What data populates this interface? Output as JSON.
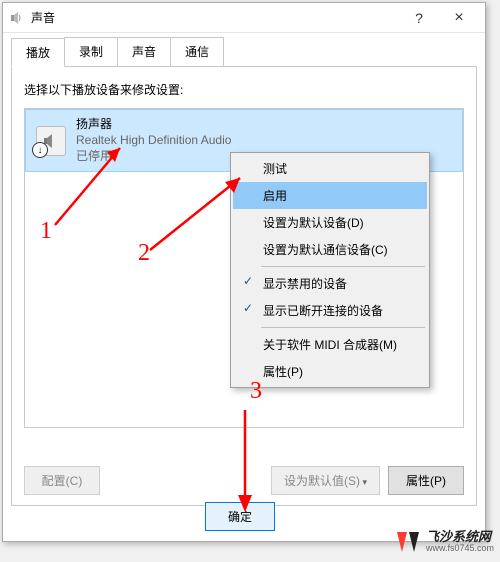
{
  "window": {
    "title": "声音",
    "close": "×",
    "help": "?"
  },
  "tabs": [
    "播放",
    "录制",
    "声音",
    "通信"
  ],
  "instruction": "选择以下播放设备来修改设置:",
  "device": {
    "name": "扬声器",
    "driver": "Realtek High Definition Audio",
    "status": "已停用"
  },
  "context_menu": {
    "test": "测试",
    "enable": "启用",
    "set_default": "设置为默认设备(D)",
    "set_comm": "设置为默认通信设备(C)",
    "show_disabled": "显示禁用的设备",
    "show_disconnected": "显示已断开连接的设备",
    "about_midi": "关于软件 MIDI 合成器(M)",
    "properties": "属性(P)"
  },
  "buttons": {
    "configure": "配置(C)",
    "set_default": "设为默认值(S)",
    "properties": "属性(P)",
    "ok": "确定"
  },
  "annotations": {
    "a1": "1",
    "a2": "2",
    "a3": "3"
  },
  "watermark": {
    "main": "飞沙系统网",
    "sub": "www.fs0745.com"
  }
}
